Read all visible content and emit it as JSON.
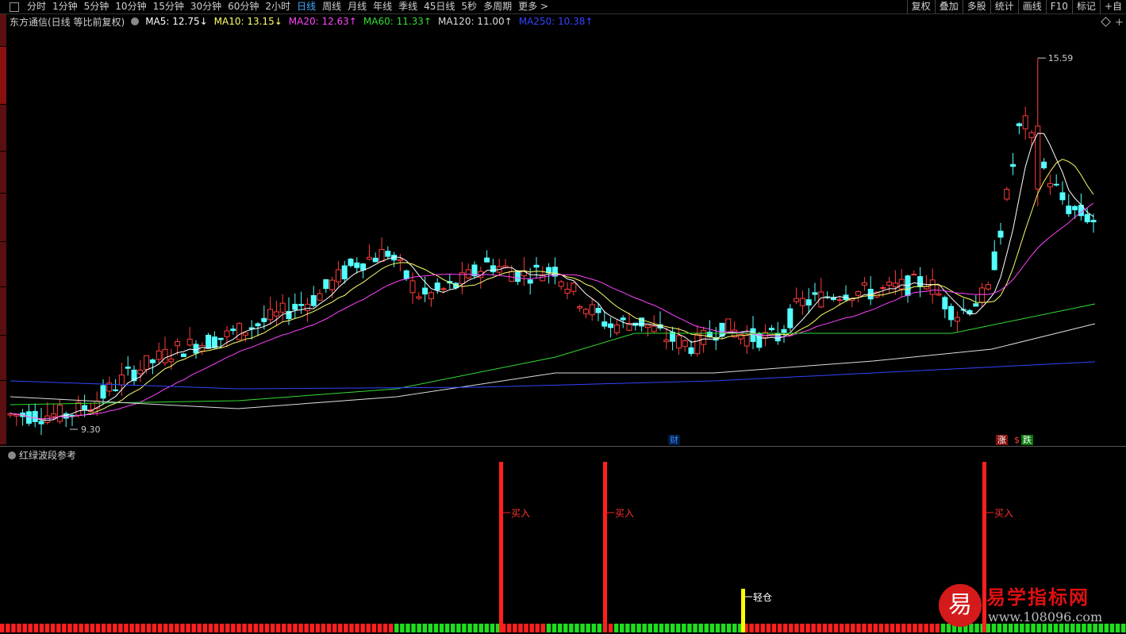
{
  "toolbar": {
    "periods": [
      "分时",
      "1分钟",
      "5分钟",
      "10分钟",
      "15分钟",
      "30分钟",
      "60分钟",
      "2小时",
      "日线",
      "周线",
      "月线",
      "年线",
      "季线",
      "45日线",
      "5秒",
      "多周期",
      "更多 >"
    ],
    "active_period": "日线",
    "right_items": [
      "复权",
      "叠加",
      "多股",
      "统计",
      "画线",
      "F10",
      "标记",
      "+自"
    ]
  },
  "main_chart": {
    "stock_title": "东方通信(日线 等比前复权)",
    "ma_labels": [
      {
        "text": "MA5: 12.75↓",
        "color": "#ffffff"
      },
      {
        "text": "MA10: 13.15↓",
        "color": "#ffff66"
      },
      {
        "text": "MA20: 12.63↑",
        "color": "#ff44ff"
      },
      {
        "text": "MA60: 11.33↑",
        "color": "#33dd33"
      },
      {
        "text": "MA120: 11.00↑",
        "color": "#dddddd"
      },
      {
        "text": "MA250: 10.38↑",
        "color": "#3344ff"
      }
    ],
    "high_label": "15.59",
    "low_label": "9.30",
    "markers": {
      "cai": "财",
      "zhang": "涨",
      "dollar": "$",
      "die": "跌"
    }
  },
  "indicator": {
    "title": "红绿波段参考",
    "signals": [
      {
        "label": "买入",
        "type": "buy"
      },
      {
        "label": "买入",
        "type": "buy"
      },
      {
        "label": "轻仓",
        "type": "light"
      },
      {
        "label": "买入",
        "type": "buy"
      }
    ]
  },
  "watermark": {
    "icon_char": "易",
    "name": "易学指标网",
    "url": "www.108096.com"
  },
  "colors": {
    "up": "#ff3c3c",
    "down": "#54ffff",
    "buy_bar": "#ff1f1f",
    "light_bar": "#ffff00",
    "band_red": "#ff1f1f",
    "band_green": "#1fdd1f"
  }
}
